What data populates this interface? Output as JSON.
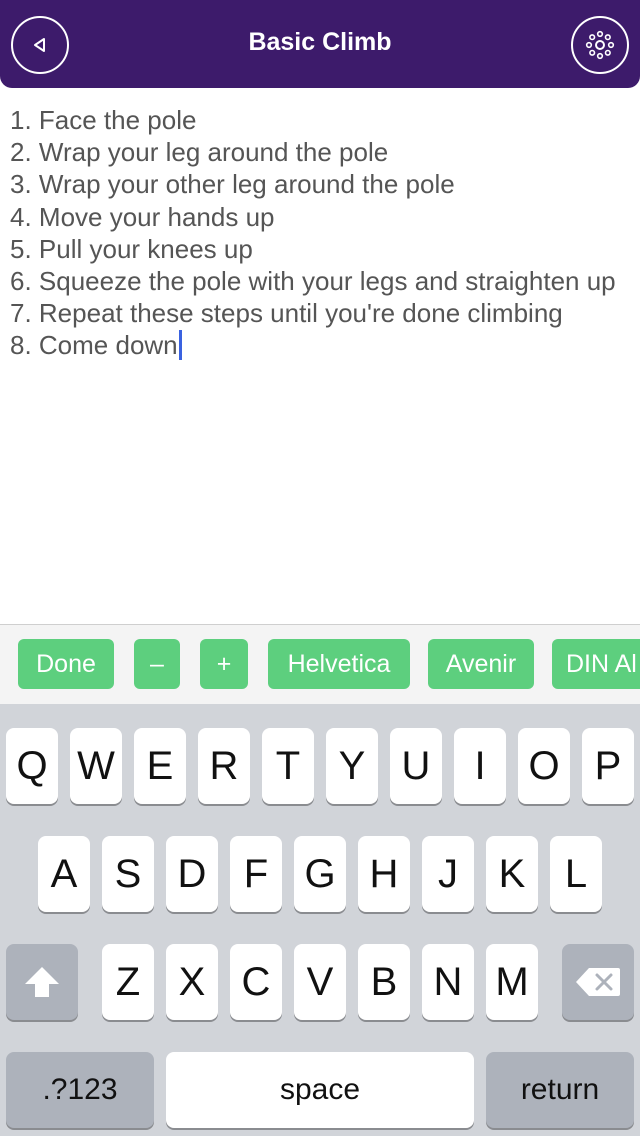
{
  "header": {
    "title": "Basic Climb",
    "back_icon": "back-triangle-icon",
    "settings_icon": "gear-dots-icon",
    "background": "#3d1b6b"
  },
  "editor": {
    "lines": [
      "1. Face the pole",
      "2. Wrap your leg around the pole",
      "3. Wrap your other leg around the pole",
      "4. Move your hands up",
      "5. Pull your knees up",
      "6. Squeeze the pole with your legs and straighten up",
      "7. Repeat these steps until you're done climbing",
      "8. Come down"
    ],
    "caret_color": "#3a62e0"
  },
  "toolbar": {
    "done": "Done",
    "minus": "–",
    "plus": "+",
    "font_helvetica": "Helvetica",
    "font_avenir": "Avenir",
    "font_din": "DIN Al",
    "button_color": "#5dcf7e"
  },
  "keyboard": {
    "row1": [
      "Q",
      "W",
      "E",
      "R",
      "T",
      "Y",
      "U",
      "I",
      "O",
      "P"
    ],
    "row2": [
      "A",
      "S",
      "D",
      "F",
      "G",
      "H",
      "J",
      "K",
      "L"
    ],
    "row3": [
      "Z",
      "X",
      "C",
      "V",
      "B",
      "N",
      "M"
    ],
    "shift_icon": "shift-arrow-icon",
    "backspace_icon": "backspace-icon",
    "numbers": ".?123",
    "space": "space",
    "return": "return"
  }
}
